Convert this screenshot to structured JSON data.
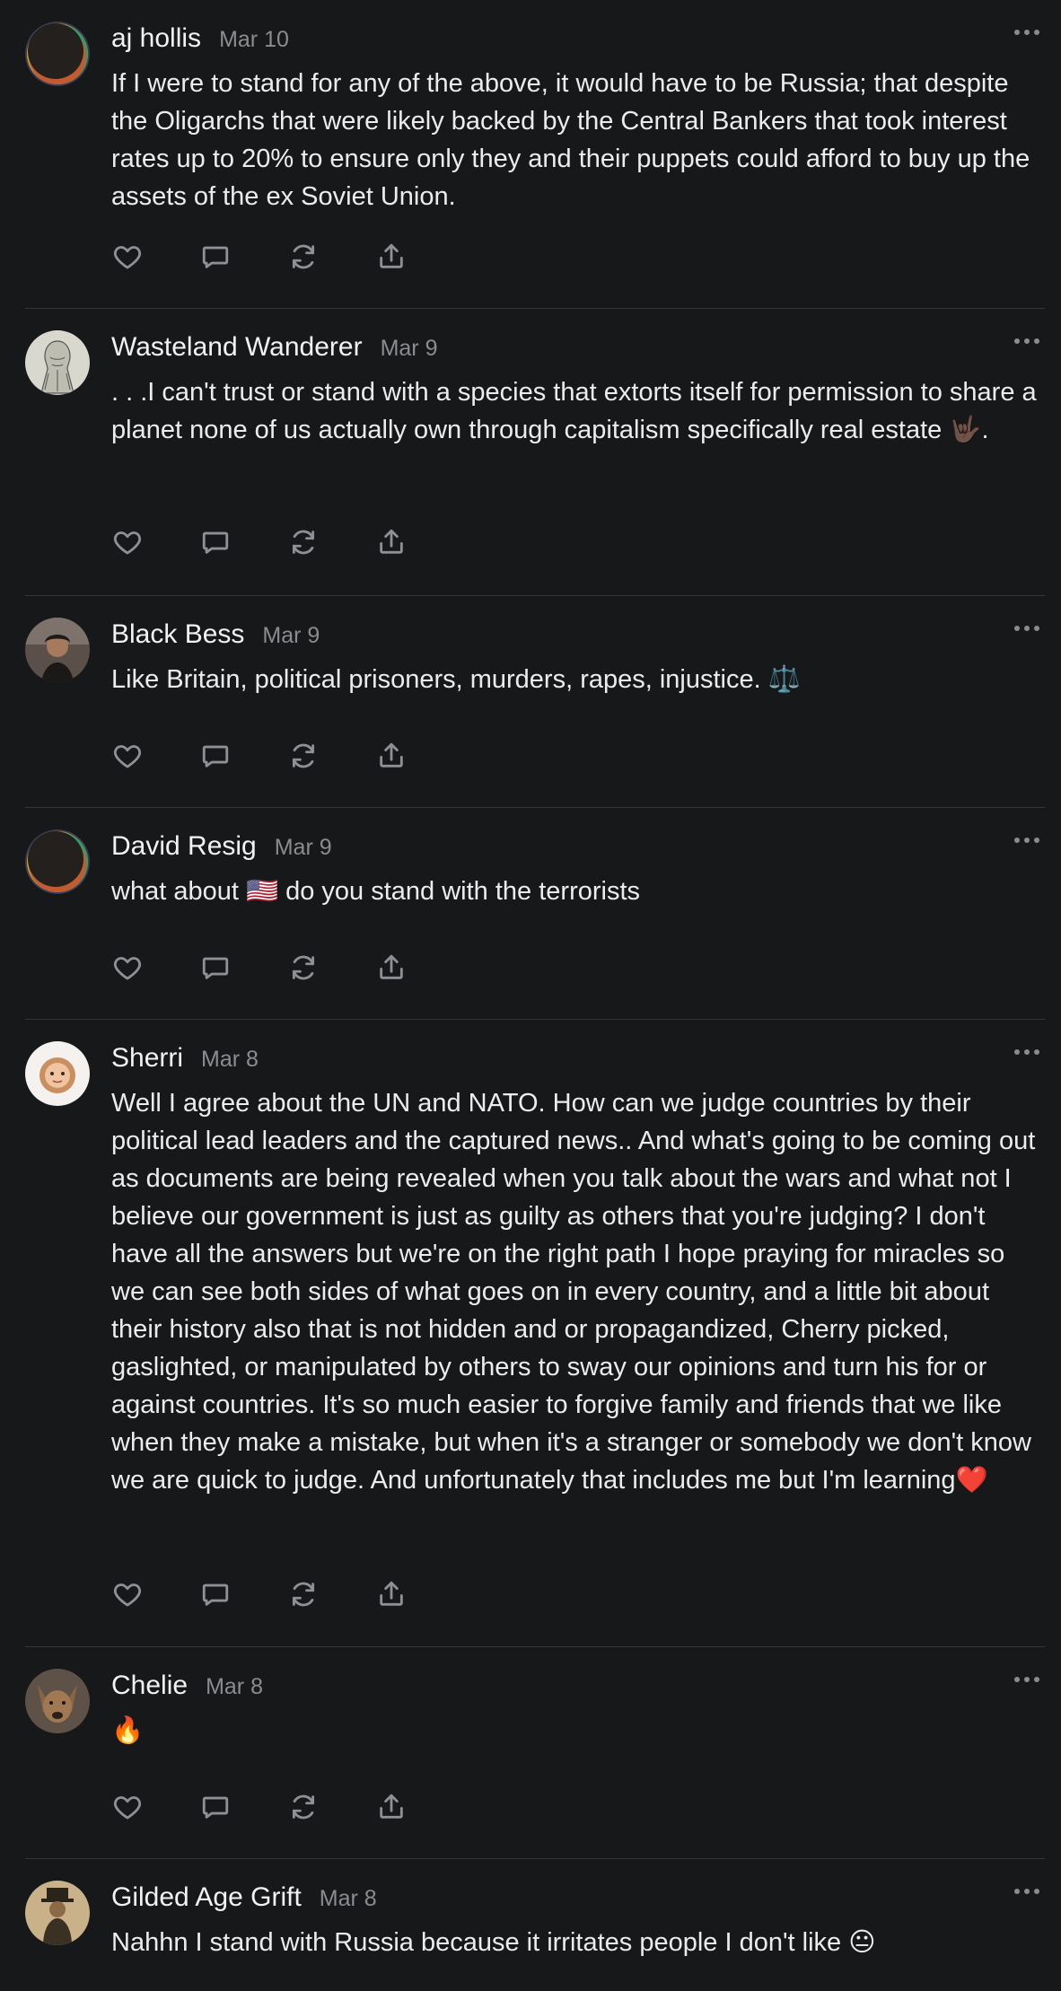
{
  "comments": [
    {
      "author": "aj hollis",
      "date": "Mar 10",
      "text": "If I were to stand for any of the above, it would have to be Russia; that despite the Oligarchs that were likely backed by the Central Bankers that took interest rates up to 20% to ensure only they and their puppets could afford to buy up the assets of the ex Soviet Union.",
      "avatar": "ring-avatar"
    },
    {
      "author": "Wasteland Wanderer",
      "date": "Mar 9",
      "text": ". . .I can't trust or stand with a species that extorts itself for permission to share a planet none of us actually own through capitalism specifically real estate 🤟🏿.",
      "avatar": "sketch-avatar"
    },
    {
      "author": "Black Bess",
      "date": "Mar 9",
      "text": "Like Britain, political prisoners, murders, rapes, injustice. ⚖️",
      "avatar": "photo-avatar"
    },
    {
      "author": "David Resig",
      "date": "Mar 9",
      "text": "what about 🇺🇸 do you stand with the terrorists",
      "avatar": "ring-avatar"
    },
    {
      "author": "Sherri",
      "date": "Mar 8",
      "text": "Well I agree about the UN and NATO. How can we judge countries by their political lead leaders and the captured news.. And what's going to be coming out as documents are being revealed when you talk about the wars and what not I believe our government is just as guilty as others that you're judging? I don't have all the answers but we're on the right path I hope praying for miracles so we can see both sides of what goes on in every country, and a little bit about their history also that is not hidden and or propagandized, Cherry picked, gaslighted, or manipulated by others to sway our opinions and turn his for or against countries. It's so much easier to forgive family and friends that we like when they make a mistake, but when it's a stranger or somebody we don't know we are quick to judge. And unfortunately that includes me but I'm learning❤️",
      "avatar": "memoji-avatar"
    },
    {
      "author": "Chelie",
      "date": "Mar 8",
      "text": "🔥",
      "avatar": "dog-avatar"
    },
    {
      "author": "Gilded Age Grift",
      "date": "Mar 8",
      "text": "Nahhn I stand with Russia because it irritates people I don't like 😐",
      "avatar": "portrait-avatar"
    }
  ],
  "actions": [
    "like",
    "reply",
    "restack",
    "share"
  ],
  "colors": {
    "background": "#17181a",
    "text": "#ececec",
    "muted": "#8a8c90",
    "divider": "#34363a"
  }
}
